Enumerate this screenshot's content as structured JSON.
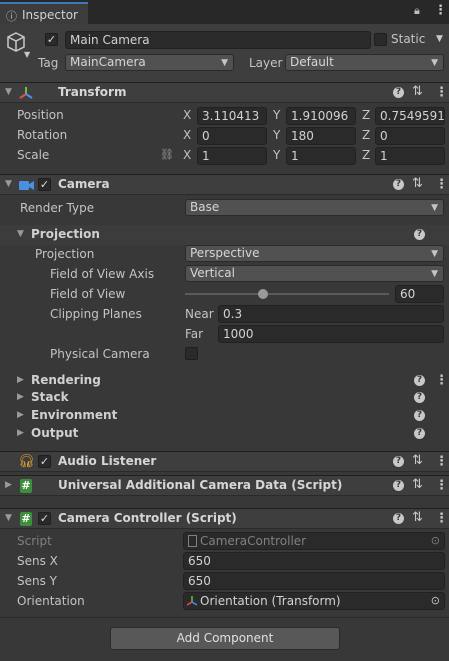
{
  "tab": {
    "title": "Inspector"
  },
  "object": {
    "name": "Main Camera",
    "static_label": "Static",
    "tag_label": "Tag",
    "tag_value": "MainCamera",
    "layer_label": "Layer",
    "layer_value": "Default"
  },
  "transform": {
    "title": "Transform",
    "position_label": "Position",
    "rotation_label": "Rotation",
    "scale_label": "Scale",
    "x": "X",
    "y": "Y",
    "z": "Z",
    "position": [
      "3.110413",
      "1.910096",
      "0.7549591"
    ],
    "rotation": [
      "0",
      "180",
      "0"
    ],
    "scale": [
      "1",
      "1",
      "1"
    ]
  },
  "camera": {
    "title": "Camera",
    "render_type_label": "Render Type",
    "render_type_value": "Base",
    "projection_section": "Projection",
    "projection_label": "Projection",
    "projection_value": "Perspective",
    "fov_axis_label": "Field of View Axis",
    "fov_axis_value": "Vertical",
    "fov_label": "Field of View",
    "fov_value": "60",
    "fov_slider_fraction": 0.38,
    "clipping_label": "Clipping Planes",
    "near_label": "Near",
    "near_value": "0.3",
    "far_label": "Far",
    "far_value": "1000",
    "physical_label": "Physical Camera",
    "sections": [
      "Rendering",
      "Stack",
      "Environment",
      "Output"
    ]
  },
  "audio_listener": {
    "title": "Audio Listener"
  },
  "urp_data": {
    "title": "Universal Additional Camera Data (Script)"
  },
  "controller": {
    "title": "Camera Controller (Script)",
    "script_label": "Script",
    "script_value": "CameraController",
    "sensx_label": "Sens X",
    "sensx_value": "650",
    "sensy_label": "Sens Y",
    "sensy_value": "650",
    "orientation_label": "Orientation",
    "orientation_value": "Orientation (Transform)"
  },
  "add_component": "Add Component"
}
